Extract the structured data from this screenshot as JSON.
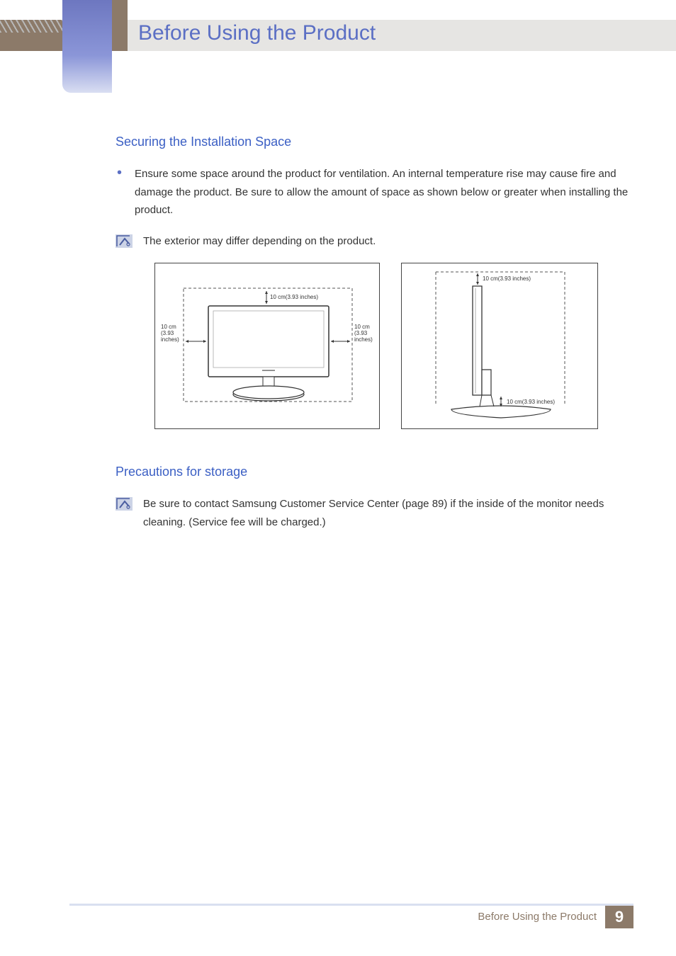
{
  "header": {
    "title": "Before Using the Product"
  },
  "section1": {
    "heading": "Securing the Installation Space",
    "bullet": "Ensure some space around the product for ventilation. An internal temperature rise may cause fire and damage the product. Be sure to allow the amount of space as shown below or greater when installing the product.",
    "note": "The exterior may differ depending on the product.",
    "diagram": {
      "top": "10 cm(3.93 inches)",
      "left1": "10 cm",
      "left2": "(3.93",
      "left3": "inches)",
      "right1": "10 cm",
      "right2": "(3.93",
      "right3": "inches)",
      "side_top": "10 cm(3.93 inches)",
      "side_bottom": "10 cm(3.93 inches)"
    }
  },
  "section2": {
    "heading": "Precautions for storage",
    "note": "Be sure to contact Samsung Customer Service Center (page 89) if the inside of the monitor needs cleaning. (Service fee will be charged.)"
  },
  "footer": {
    "title": "Before Using the Product",
    "page": "9"
  }
}
